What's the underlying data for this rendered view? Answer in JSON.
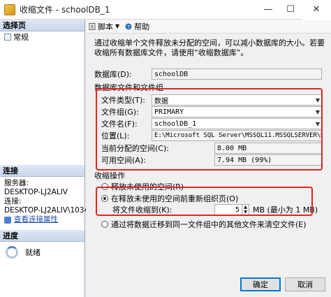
{
  "window": {
    "title": "收缩文件 - schoolDB_1",
    "minimize": "—",
    "maximize": "☐",
    "close": "✕"
  },
  "left_pane": {
    "select_page_header": "选择页",
    "pages": [
      {
        "label": "常规"
      }
    ],
    "connection_header": "连接",
    "server_label": "服务器:",
    "server_value": "DESKTOP-LJ2ALIV",
    "connection_label": "连接:",
    "connection_value": "DESKTOP-LJ2ALIV\\1034",
    "view_connection_link": "查看连接属性",
    "progress_header": "进度",
    "progress_status": "就绪"
  },
  "toolbar": {
    "script_label": "脚本",
    "help_label": "帮助"
  },
  "description": "通过收缩单个文件释放未分配的空间，可以减小数据库的大小。若要收缩所有数据库文件，请使用“收缩数据库”。",
  "form": {
    "database_label": "数据库(D):",
    "database_value": "schoolDB",
    "section_files": "数据库文件和文件组",
    "file_type_label": "文件类型(T):",
    "file_type_value": "数据",
    "filegroup_label": "文件组(G):",
    "filegroup_value": "PRIMARY",
    "file_name_label": "文件名(F):",
    "file_name_value": "schoolDB_1",
    "location_label": "位置(L):",
    "location_value": "E:\\Microsoft SQL Server\\MSSQL11.MSSQLSERVER\\M",
    "allocated_label": "当前分配的空间(C):",
    "allocated_value": "8.00 MB",
    "available_label": "可用空间(A):",
    "available_value": "7.94 MB (99%)",
    "section_shrink": "收缩操作",
    "option_release": "释放未使用的空间(R)",
    "option_reorganize": "在释放未使用的空间前重新组织页(O)",
    "shrink_to_label": "将文件收缩到(K):",
    "shrink_to_value": "5",
    "shrink_to_hint": "MB (最小为 1 MB)",
    "option_empty": "通过将数据迁移到同一文件组中的其他文件来清空文件(E)"
  },
  "buttons": {
    "ok": "确定",
    "cancel": "取消"
  }
}
